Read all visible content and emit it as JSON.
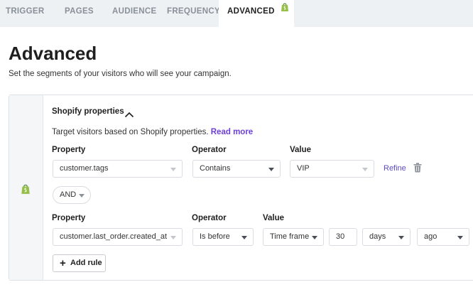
{
  "tabs": [
    {
      "label": "TRIGGER"
    },
    {
      "label": "PAGES"
    },
    {
      "label": "AUDIENCE"
    },
    {
      "label": "FREQUENCY"
    },
    {
      "label": "ADVANCED",
      "active": true
    }
  ],
  "header": {
    "title": "Advanced",
    "subtitle": "Set the segments of your visitors who will see your campaign."
  },
  "section": {
    "title": "Shopify properties",
    "description": "Target visitors based on Shopify properties.",
    "read_more": "Read more"
  },
  "rule1": {
    "property_label": "Property",
    "operator_label": "Operator",
    "value_label": "Value",
    "property": "customer.tags",
    "operator": "Contains",
    "value": "VIP",
    "refine": "Refine"
  },
  "connector": "AND",
  "rule2": {
    "property_label": "Property",
    "operator_label": "Operator",
    "value_label": "Value",
    "property": "customer.last_order.created_at",
    "operator": "Is before",
    "value_type": "Time frame",
    "amount": "30",
    "unit": "days",
    "direction": "ago"
  },
  "add_rule": "Add rule",
  "colors": {
    "accent": "#6d3fd6",
    "shopify_green": "#95bf47",
    "tab_bar": "#eef1f4"
  },
  "icons": [
    "shopify-icon",
    "chevron-up-icon",
    "chevron-down-icon",
    "trash-icon",
    "plus-icon"
  ]
}
